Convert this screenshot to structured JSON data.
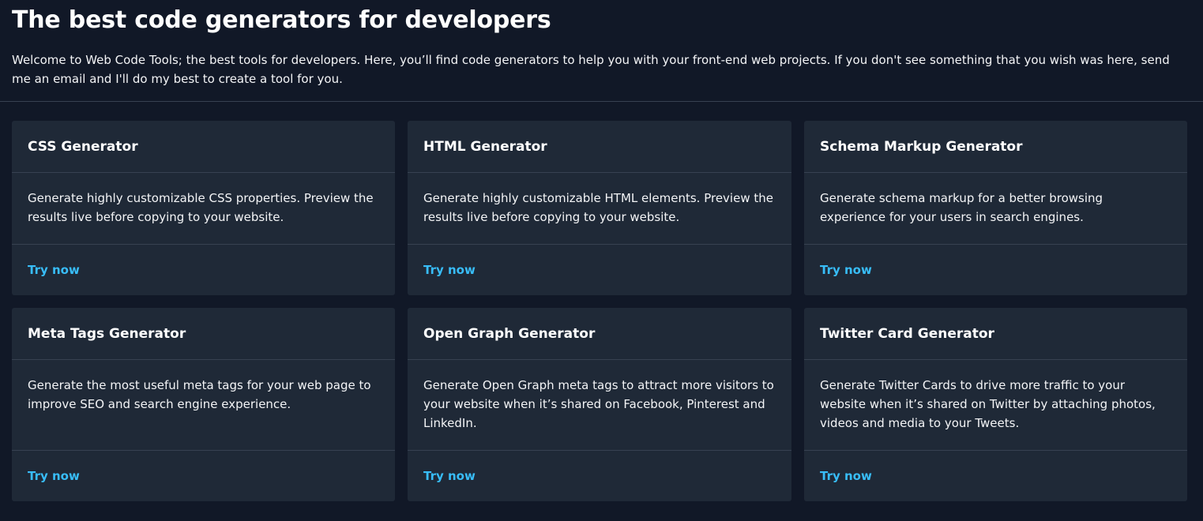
{
  "hero": {
    "title": "The best code generators for developers",
    "intro": "Welcome to Web Code Tools; the best tools for developers. Here, you’ll find code generators to help you with your front-end web projects. If you don't see something that you wish was here, send me an email and I'll do my best to create a tool for you."
  },
  "cards": [
    {
      "title": "CSS Generator",
      "description": "Generate highly customizable CSS properties. Preview the results live before copying to your website.",
      "cta": "Try now"
    },
    {
      "title": "HTML Generator",
      "description": "Generate highly customizable HTML elements. Preview the results live before copying to your website.",
      "cta": "Try now"
    },
    {
      "title": "Schema Markup Generator",
      "description": "Generate schema markup for a better browsing experience for your users in search engines.",
      "cta": "Try now"
    },
    {
      "title": "Meta Tags Generator",
      "description": "Generate the most useful meta tags for your web page to improve SEO and search engine experience.",
      "cta": "Try now"
    },
    {
      "title": "Open Graph Generator",
      "description": "Generate Open Graph meta tags to attract more visitors to your website when it’s shared on Facebook, Pinterest and LinkedIn.",
      "cta": "Try now"
    },
    {
      "title": "Twitter Card Generator",
      "description": "Generate Twitter Cards to drive more traffic to your website when it’s shared on Twitter by attaching photos, videos and media to your Tweets.",
      "cta": "Try now"
    }
  ],
  "colors": {
    "background": "#111827",
    "card": "#1f2937",
    "divider": "#374151",
    "link": "#38bdf8"
  }
}
